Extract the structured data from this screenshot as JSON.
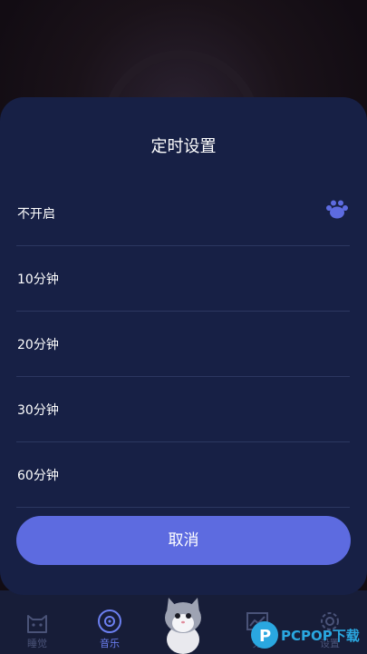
{
  "sheet": {
    "title": "定时设置",
    "options": [
      {
        "label": "不开启",
        "selected": true
      },
      {
        "label": "10分钟",
        "selected": false
      },
      {
        "label": "20分钟",
        "selected": false
      },
      {
        "label": "30分钟",
        "selected": false
      },
      {
        "label": "60分钟",
        "selected": false
      }
    ],
    "selected_icon": "paw-icon",
    "cancel_label": "取消"
  },
  "nav": {
    "items": [
      {
        "label": "睡觉",
        "icon": "cat-face-icon",
        "active": false
      },
      {
        "label": "音乐",
        "icon": "music-disc-icon",
        "active": true
      },
      {
        "label": "分",
        "icon": "chart-icon",
        "active": false
      },
      {
        "label": "设置",
        "icon": "gear-icon",
        "active": false
      }
    ],
    "center_icon": "cat-mascot-icon"
  },
  "watermark": {
    "text": "PCPOP下载"
  },
  "colors": {
    "accent": "#5d6be0",
    "sheet_bg": "#172045",
    "nav_active": "#6b7ff0"
  }
}
